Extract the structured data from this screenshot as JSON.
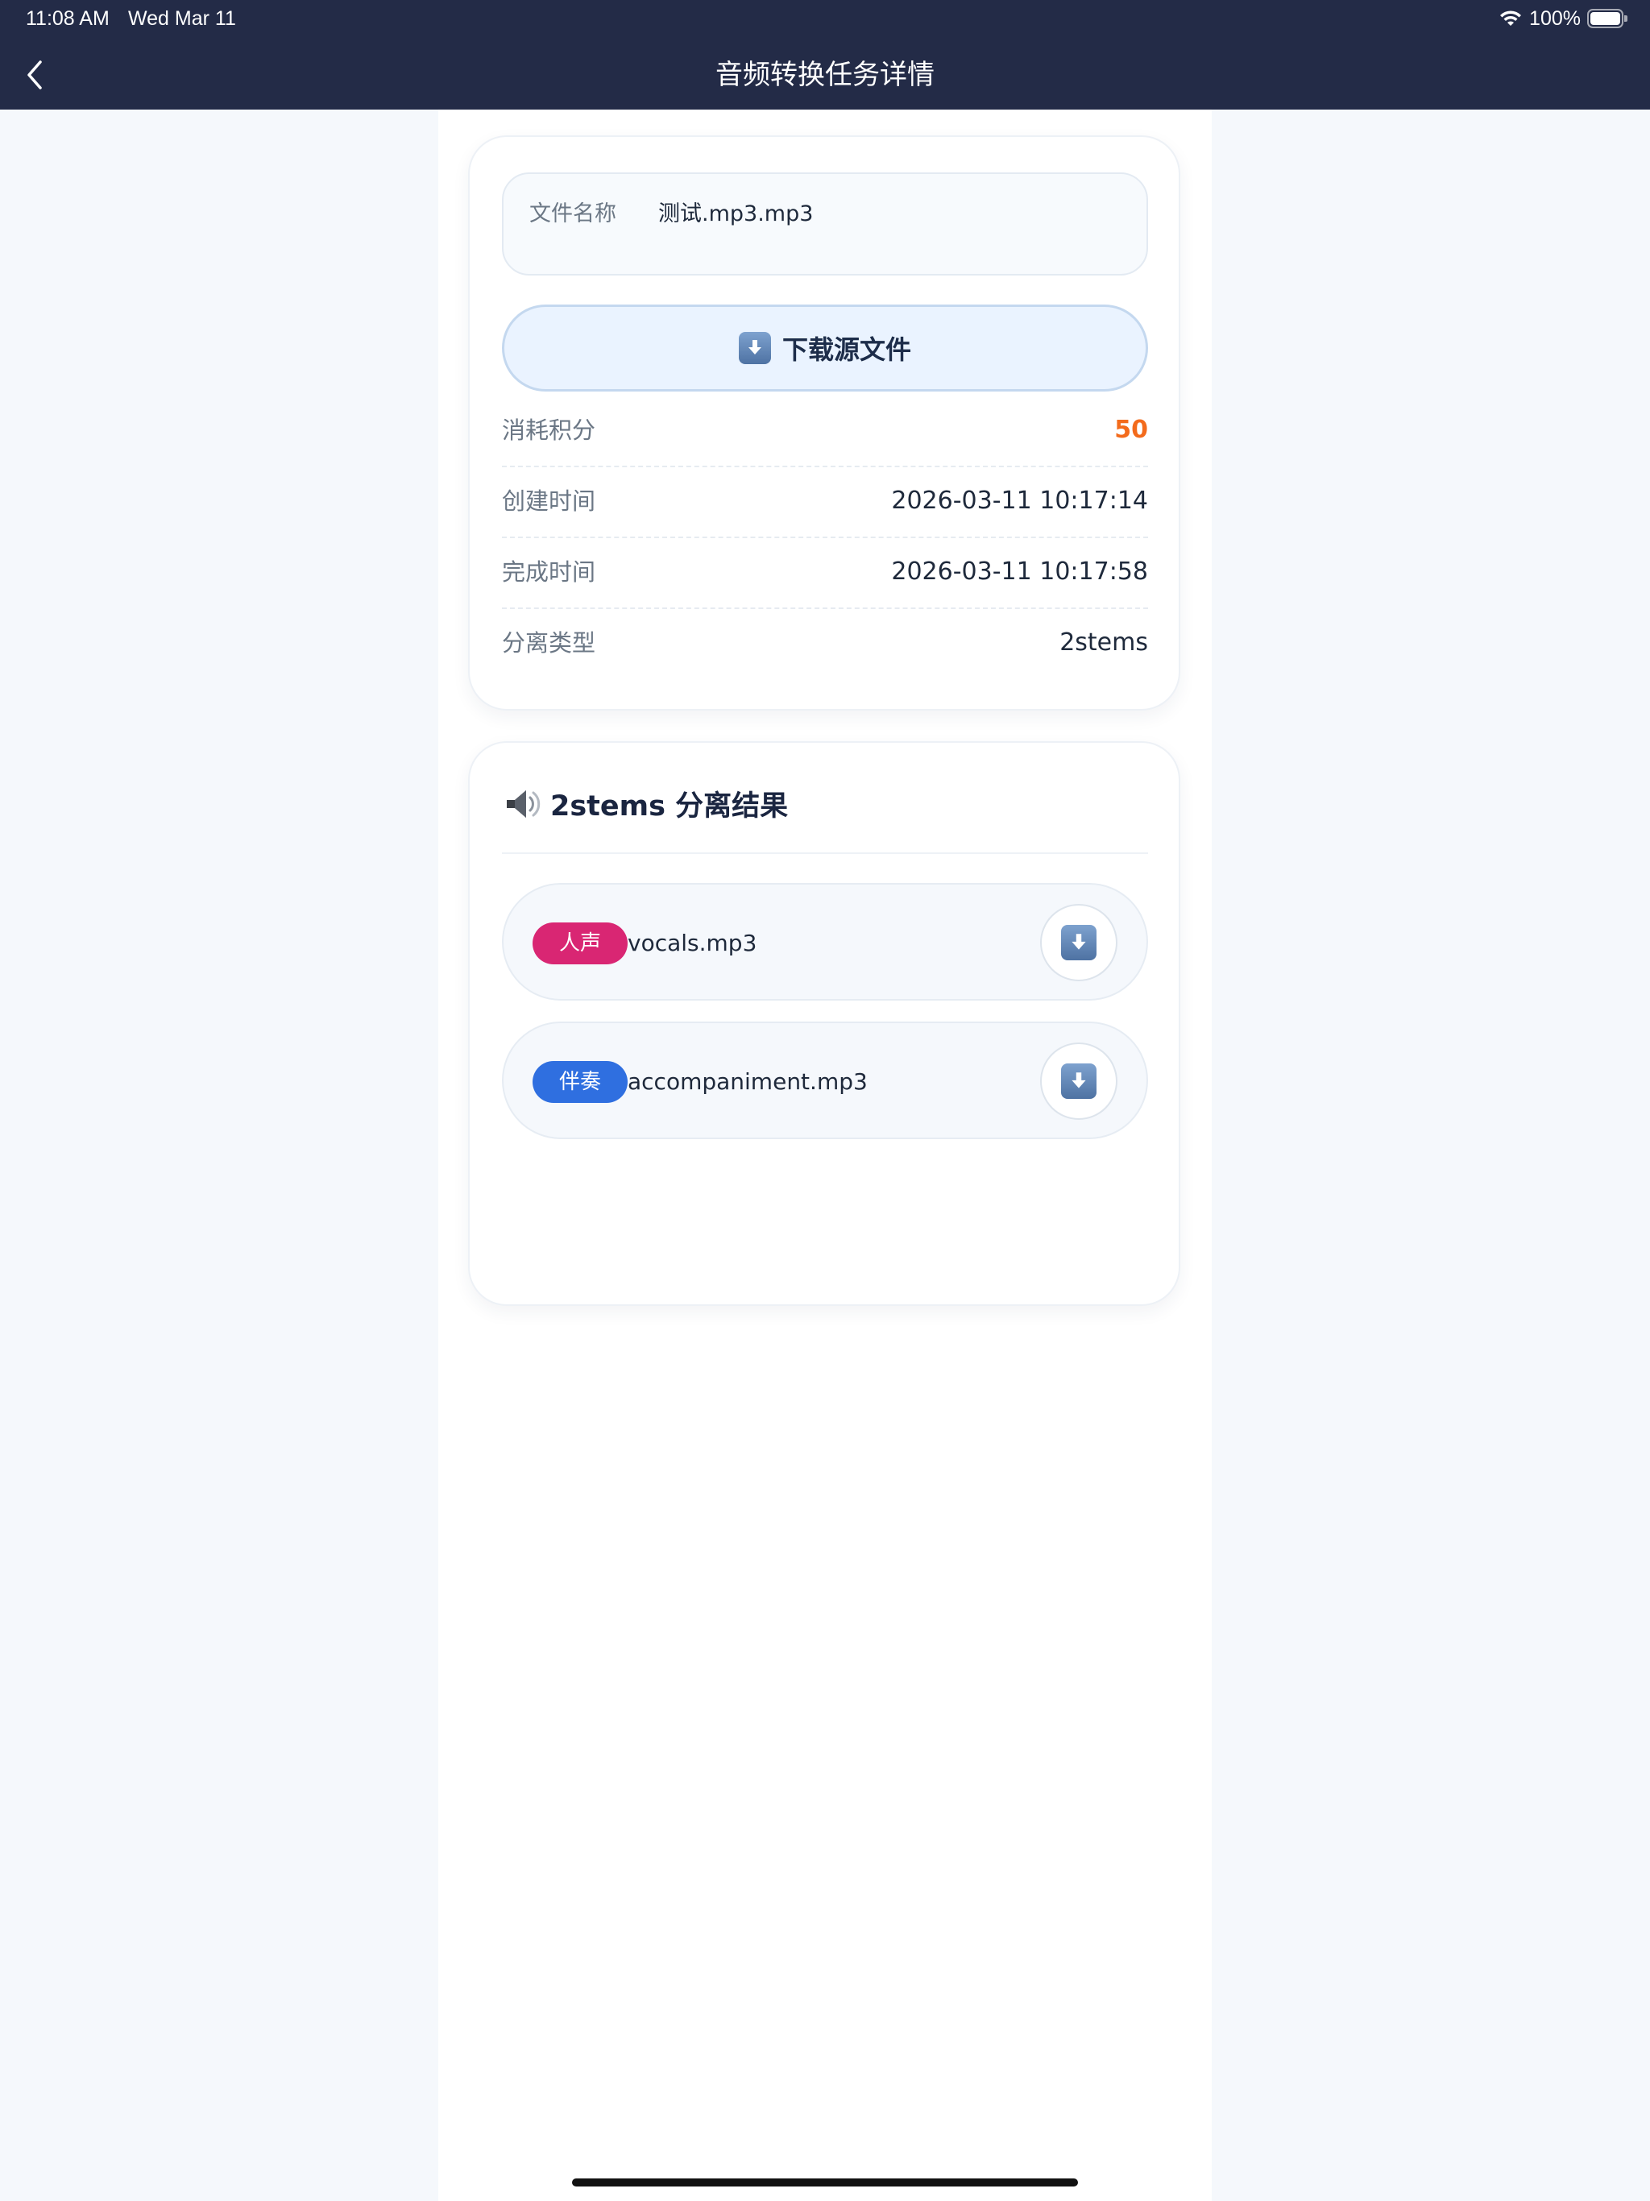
{
  "status_bar": {
    "time": "11:08 AM",
    "date": "Wed Mar 11",
    "battery": "100%"
  },
  "header": {
    "title": "音频转换任务详情",
    "back_icon": "chevron-left-icon"
  },
  "file": {
    "label": "文件名称",
    "name": "测试.mp3.mp3"
  },
  "download_source": {
    "label": "下载源文件",
    "icon": "download-arrow-icon"
  },
  "details": [
    {
      "label": "消耗积分",
      "value": "50"
    },
    {
      "label": "创建时间",
      "value": "2026-03-11 10:17:14"
    },
    {
      "label": "完成时间",
      "value": "2026-03-11 10:17:58"
    },
    {
      "label": "分离类型",
      "value": "2stems"
    }
  ],
  "results": {
    "title": "2stems 分离结果",
    "icon": "speaker-icon",
    "items": [
      {
        "tag": "人声",
        "tag_color": "#d92673",
        "file": "vocals.mp3"
      },
      {
        "tag": "伴奏",
        "tag_color": "#2f6fe0",
        "file": "accompaniment.mp3"
      }
    ]
  },
  "colors": {
    "header_bg": "#232b47",
    "points": "#f36b1c",
    "accent_button_bg": "#eaf3ff"
  }
}
